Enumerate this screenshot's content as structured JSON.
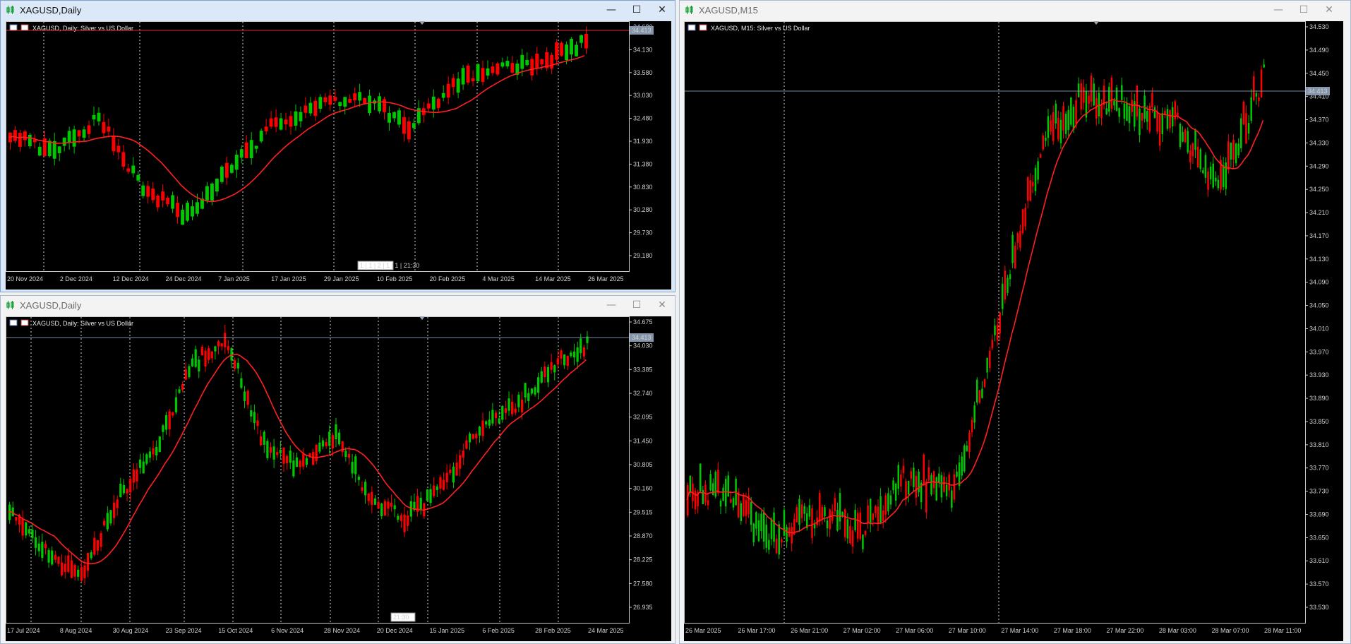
{
  "windows": [
    {
      "id": "w1",
      "title": "XAGUSD,Daily",
      "active": true,
      "header": "XAGUSD, Daily:  Silver vs US Dollar",
      "price_tag": "34.413",
      "price_levels": [
        "34.680",
        "34.130",
        "33.580",
        "33.030",
        "32.480",
        "31.930",
        "31.380",
        "30.830",
        "30.280",
        "29.730",
        "29.180"
      ],
      "date_labels": [
        "20 Nov 2024",
        "2 Dec 2024",
        "12 Dec 2024",
        "24 Dec 2024",
        "7 Jan 2025",
        "17 Jan 2025",
        "29 Jan 2025",
        "10 Feb 2025",
        "20 Feb 2025",
        "4 Mar 2025",
        "14 Mar 2025",
        "26 Mar 2025"
      ],
      "timer": "1 | 1 | 2 | 1 | 1 | 21:30"
    },
    {
      "id": "w2",
      "title": "XAGUSD,Daily",
      "active": false,
      "header": "XAGUSD, Daily:  Silver vs US Dollar",
      "price_tag": "34.413",
      "price_levels": [
        "34.675",
        "34.030",
        "33.385",
        "32.740",
        "32.095",
        "31.450",
        "30.805",
        "30.160",
        "29.515",
        "28.870",
        "28.225",
        "27.580",
        "26.935"
      ],
      "date_labels": [
        "17 Jul 2024",
        "8 Aug 2024",
        "30 Aug 2024",
        "23 Sep 2024",
        "15 Oct 2024",
        "6 Nov 2024",
        "28 Nov 2024",
        "20 Dec 2024",
        "15 Jan 2025",
        "6 Feb 2025",
        "28 Feb 2025",
        "24 Mar 2025"
      ],
      "timer": "21:30"
    },
    {
      "id": "w3",
      "title": "XAGUSD,M15",
      "active": false,
      "header": "XAGUSD, M15:  Silver vs US Dollar",
      "price_tag": "34.413",
      "price_levels": [
        "34.530",
        "34.490",
        "34.450",
        "34.410",
        "34.370",
        "34.330",
        "34.290",
        "34.250",
        "34.210",
        "34.170",
        "34.130",
        "34.090",
        "34.050",
        "34.010",
        "33.970",
        "33.930",
        "33.890",
        "33.850",
        "33.810",
        "33.770",
        "33.730",
        "33.690",
        "33.650",
        "33.610",
        "33.570",
        "33.530"
      ],
      "date_labels": [
        "26 Mar 2025",
        "26 Mar 17:00",
        "26 Mar 21:00",
        "27 Mar 02:00",
        "27 Mar 06:00",
        "27 Mar 10:00",
        "27 Mar 14:00",
        "27 Mar 18:00",
        "27 Mar 22:00",
        "28 Mar 03:00",
        "28 Mar 07:00",
        "28 Mar 11:00"
      ]
    }
  ],
  "colors": {
    "bull": "#00c800",
    "bear": "#ff0000",
    "ma": "#ff2020",
    "bid": "#7a8aa0",
    "grid": "#c0c0c0"
  },
  "icons": {
    "window": "candlestick-icon",
    "minimize": "minimize-icon",
    "maximize": "maximize-icon",
    "close": "close-icon"
  }
}
